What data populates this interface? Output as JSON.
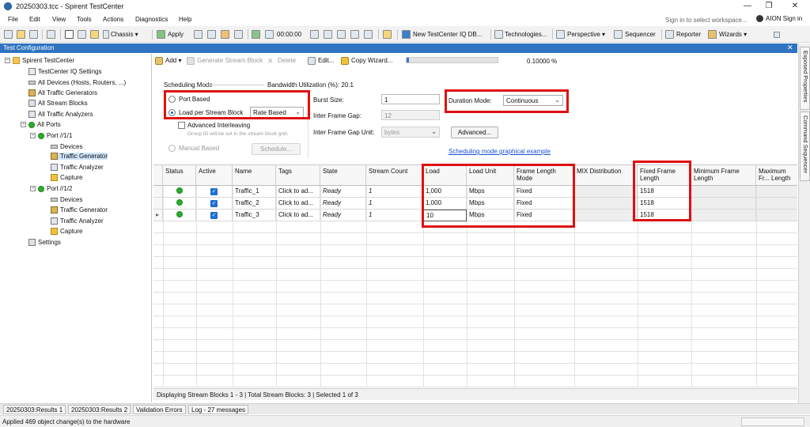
{
  "window": {
    "title": "20250303.tcc - Spirent TestCenter",
    "controls": [
      "—",
      "❐",
      "✕"
    ]
  },
  "menubar": {
    "items": [
      "File",
      "Edit",
      "View",
      "Tools",
      "Actions",
      "Diagnostics",
      "Help"
    ],
    "sign_in_workspace": "Sign in to select workspace...",
    "user": "AION Sign in"
  },
  "toolbar": {
    "chassis": "Chassis ▾",
    "apply": "Apply",
    "timer": "00:00:00",
    "iq_db": "New TestCenter IQ DB...",
    "technologies": "Technologies...",
    "perspective": "Perspective ▾",
    "sequencer": "Sequencer",
    "reporter": "Reporter",
    "wizards": "Wizards ▾"
  },
  "panel": {
    "title": "Test Configuration",
    "close": "✕",
    "side_tabs": [
      "Exposed Properties",
      "Command Sequencer"
    ]
  },
  "tree": {
    "items": [
      {
        "label": "Spirent TestCenter",
        "level": 0
      },
      {
        "label": "TestCenter IQ Settings",
        "level": 1
      },
      {
        "label": "All Devices (Hosts, Routers, ...)",
        "level": 1
      },
      {
        "label": "All Traffic Generators",
        "level": 1
      },
      {
        "label": "All Stream Blocks",
        "level": 1
      },
      {
        "label": "All Traffic Analyzers",
        "level": 1
      },
      {
        "label": "All Ports",
        "level": 1
      },
      {
        "label": "Port //1/1",
        "level": 2
      },
      {
        "label": "Devices",
        "level": 3
      },
      {
        "label": "Traffic Generator",
        "level": 3
      },
      {
        "label": "Traffic Analyzer",
        "level": 3
      },
      {
        "label": "Capture",
        "level": 3
      },
      {
        "label": "Port //1/2",
        "level": 2
      },
      {
        "label": "Devices",
        "level": 3
      },
      {
        "label": "Traffic Generator",
        "level": 3
      },
      {
        "label": "Traffic Analyzer",
        "level": 3
      },
      {
        "label": "Capture",
        "level": 3
      },
      {
        "label": "Settings",
        "level": 1
      }
    ]
  },
  "actions": {
    "add": "Add ▾",
    "generate": "Generate Stream Block",
    "delete": "Delete",
    "edit": "Edit...",
    "copy_wizard": "Copy Wizard...",
    "progress_fraction": 0.03,
    "percent": "0.10000 %"
  },
  "scheduling": {
    "mode_label": "Scheduling Mode",
    "bandwidth": "Bandwidth Utilization (%): 20.1",
    "port_based": "Port Based",
    "load_per_stream": "Load per Stream Block",
    "rate_select": "Rate Based",
    "advanced_interleaving": "Advanced Interleaving",
    "interleave_note": "Group ID will be set in the stream block grid.",
    "manual_based": "Manual Based",
    "schedule_btn": "Schedule...",
    "burst_label": "Burst Size:",
    "burst_value": "1",
    "gap_label": "Inter Frame Gap:",
    "gap_value": "12",
    "gap_unit_label": "Inter Frame Gap Unit:",
    "gap_unit_value": "bytes",
    "advanced_btn": "Advanced...",
    "duration_label": "Duration Mode:",
    "duration_value": "Continuous",
    "graph_link": "Scheduling mode graphical example"
  },
  "grid": {
    "columns": [
      "",
      "Status",
      "Active",
      "Name",
      "Tags",
      "State",
      "Stream Count",
      "Load",
      "Load Unit",
      "Frame Length Mode",
      "MIX Distribution",
      "Fixed Frame Length",
      "Minimum Frame Length",
      "Maximum Fr... Length"
    ],
    "rows": [
      {
        "name": "Traffic_1",
        "tags": "Click to ad...",
        "state": "Ready",
        "count": "1",
        "load": "1,000",
        "unit": "Mbps",
        "mode": "Fixed",
        "fixed": "1518"
      },
      {
        "name": "Traffic_2",
        "tags": "Click to ad...",
        "state": "Ready",
        "count": "1",
        "load": "1,000",
        "unit": "Mbps",
        "mode": "Fixed",
        "fixed": "1518"
      },
      {
        "name": "Traffic_3",
        "tags": "Click to ad...",
        "state": "Ready",
        "count": "1",
        "load": "10",
        "unit": "Mbps",
        "mode": "Fixed",
        "fixed": "1518"
      }
    ],
    "row_pointer": "▸",
    "status": "Displaying Stream Blocks 1 - 3  |  Total Stream Blocks: 3  |  Selected 1 of 3"
  },
  "bottom_tabs": [
    "20250303:Results 1",
    "20250303:Results 2",
    "Validation Errors",
    "Log - 27 messages"
  ],
  "statusbar": {
    "text": "Applied 469 object change(s) to the hardware"
  },
  "colors": {
    "header_blue": "#2f74c0",
    "highlight_red": "#e01010",
    "status_green": "#2cab2c",
    "link_blue": "#1a4fd6"
  }
}
